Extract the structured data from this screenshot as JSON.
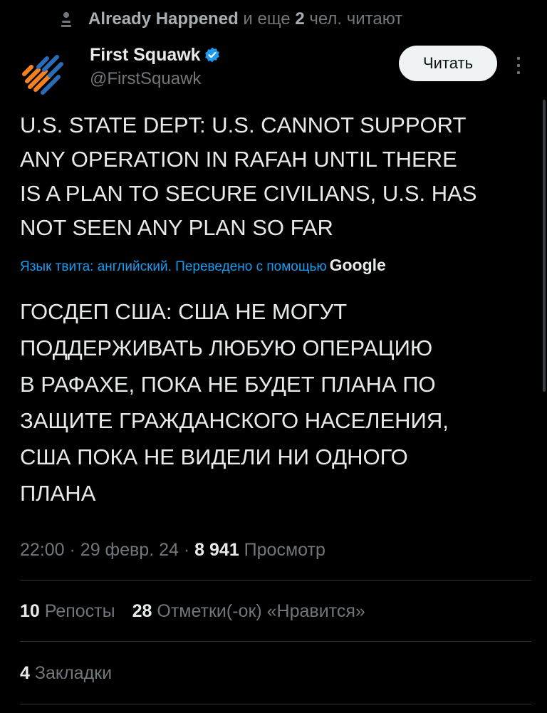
{
  "reading": {
    "name": "Already Happened",
    "mid": "и еще",
    "count": "2",
    "suffix": "чел. читают"
  },
  "author": {
    "display_name": "First Squawk",
    "handle": "@FirstSquawk",
    "verified": true,
    "follow_label": "Читать",
    "avatar_icon": "first-squawk-logo",
    "verified_color": "#1d9bf0"
  },
  "tweet": {
    "lines": [
      "U.S. STATE DEPT: U.S. CANNOT SUPPORT",
      "ANY OPERATION IN RAFAH UNTIL THERE",
      "IS A PLAN TO SECURE CIVILIANS, U.S. HAS",
      "NOT SEEN ANY PLAN SO FAR"
    ],
    "translation_note": "Язык твита: английский. Переведено с помощью",
    "translation_brand": "Google",
    "translated_lines": [
      "ГОСДЕП США: США НЕ МОГУТ",
      "ПОДДЕРЖИВАТЬ ЛЮБУЮ ОПЕРАЦИЮ",
      "В РАФАХЕ, ПОКА НЕ БУДЕТ ПЛАНА ПО",
      "ЗАЩИТЕ ГРАЖДАНСКОГО НАСЕЛЕНИЯ,",
      "США ПОКА НЕ ВИДЕЛИ НИ ОДНОГО",
      "ПЛАНА"
    ]
  },
  "meta": {
    "time": "22:00",
    "separator": "·",
    "date": "29 февр. 24",
    "views_count": "8 941",
    "views_label": "Просмотр"
  },
  "stats": {
    "reposts_count": "10",
    "reposts_label": "Репосты",
    "likes_count": "28",
    "likes_label": "Отметки(-ок) «Нравится»",
    "bookmarks_count": "4",
    "bookmarks_label": "Закладки"
  },
  "colors": {
    "background": "#000000",
    "text": "#e7e9ea",
    "secondary": "#71767b",
    "link": "#1d9bf0",
    "logo_orange": "#f5821f",
    "logo_blue": "#2b6cb8"
  }
}
